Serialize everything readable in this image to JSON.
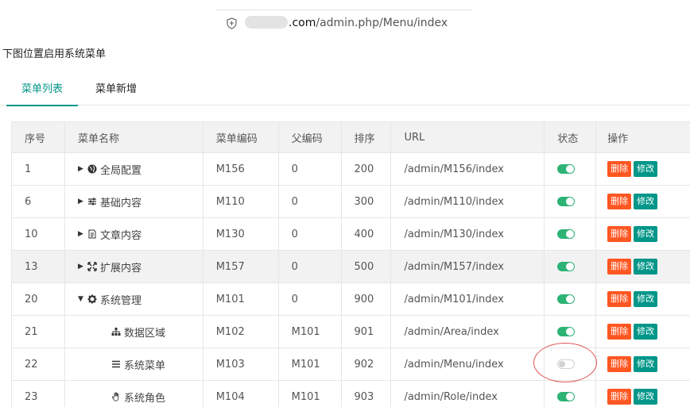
{
  "browser": {
    "url_host": ".com",
    "url_path": "/admin.php/Menu/index"
  },
  "note": "下图位置启用系统菜单",
  "tabs": [
    {
      "label": "菜单列表",
      "active": true
    },
    {
      "label": "菜单新增",
      "active": false
    }
  ],
  "table": {
    "headers": [
      "序号",
      "菜单名称",
      "菜单编码",
      "父编码",
      "排序",
      "URL",
      "状态",
      "操作"
    ],
    "rows": [
      {
        "id": "1",
        "caret": "▶",
        "icon": "globe-icon",
        "name": "全局配置",
        "code": "M156",
        "parent": "0",
        "sort": "200",
        "url": "/admin/M156/index",
        "enabled": true
      },
      {
        "id": "6",
        "caret": "▶",
        "icon": "sliders-icon",
        "name": "基础内容",
        "code": "M110",
        "parent": "0",
        "sort": "300",
        "url": "/admin/M110/index",
        "enabled": true
      },
      {
        "id": "10",
        "caret": "▶",
        "icon": "document-icon",
        "name": "文章内容",
        "code": "M130",
        "parent": "0",
        "sort": "400",
        "url": "/admin/M130/index",
        "enabled": true
      },
      {
        "id": "13",
        "caret": "▶",
        "icon": "expand-icon",
        "name": "扩展内容",
        "code": "M157",
        "parent": "0",
        "sort": "500",
        "url": "/admin/M157/index",
        "enabled": true
      },
      {
        "id": "20",
        "caret": "▼",
        "icon": "gear-icon",
        "name": "系统管理",
        "code": "M101",
        "parent": "0",
        "sort": "900",
        "url": "/admin/M101/index",
        "enabled": true
      },
      {
        "id": "21",
        "caret": "",
        "icon": "sitemap-icon",
        "name": "数据区域",
        "code": "M102",
        "parent": "M101",
        "sort": "901",
        "url": "/admin/Area/index",
        "enabled": true
      },
      {
        "id": "22",
        "caret": "",
        "icon": "menu-icon",
        "name": "系统菜单",
        "code": "M103",
        "parent": "M101",
        "sort": "902",
        "url": "/admin/Menu/index",
        "enabled": false
      },
      {
        "id": "23",
        "caret": "",
        "icon": "hand-icon",
        "name": "系统角色",
        "code": "M104",
        "parent": "M101",
        "sort": "903",
        "url": "/admin/Role/index",
        "enabled": true
      }
    ],
    "actions": {
      "delete": "删除",
      "edit": "修改"
    }
  },
  "colors": {
    "accent": "#009688",
    "switch_on": "#2db375",
    "delete": "#ff5722",
    "highlight_circle": "#e05555"
  }
}
